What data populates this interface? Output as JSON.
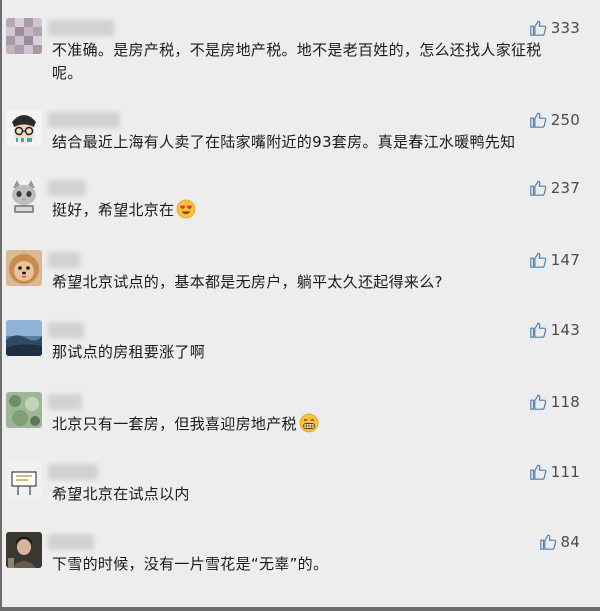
{
  "comments": [
    {
      "likes": "333",
      "text": "不准确。是房产税，不是房地产税。地不是老百姓的，怎么还找人家征税呢。",
      "avatar": "pixel-grid-avatar"
    },
    {
      "likes": "250",
      "text": "结合最近上海有人卖了在陆家嘴附近的93套房。真是春江水暖鸭先知",
      "avatar": "glasses-face-avatar"
    },
    {
      "likes": "237",
      "text": "挺好，希望北京在",
      "avatar": "cat-avatar",
      "emoji": "heart-eyes-emoji"
    },
    {
      "likes": "147",
      "text": "希望北京试点的，基本都是无房户，躺平太久还起得来么?",
      "avatar": "pomeranian-avatar"
    },
    {
      "likes": "143",
      "text": "那试点的房租要涨了啊",
      "avatar": "landscape-avatar"
    },
    {
      "likes": "118",
      "text": "北京只有一套房，但我喜迎房地产税",
      "avatar": "green-pattern-avatar",
      "emoji": "grin-emoji"
    },
    {
      "likes": "111",
      "text": "希望北京在试点以内",
      "avatar": "sign-avatar"
    },
    {
      "likes": "84",
      "text": "下雪的时候，没有一片雪花是“无辜”的。",
      "avatar": "portrait-avatar"
    }
  ],
  "colors": {
    "background": "#ededed",
    "text": "#1b1b1b",
    "likes": "#4b4b4b"
  }
}
